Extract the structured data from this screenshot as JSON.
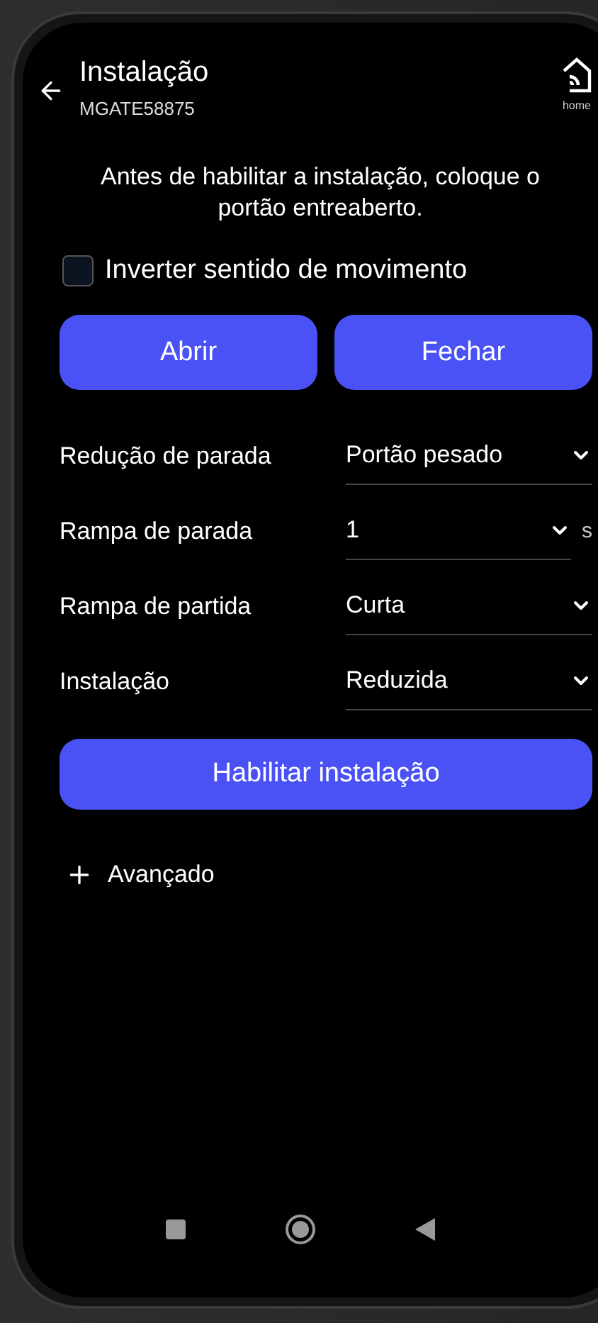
{
  "header": {
    "title": "Instalação",
    "subtitle": "MGATE58875",
    "home_label": "home"
  },
  "message": "Antes de habilitar a instalação, coloque o portão entreaberto.",
  "invert_checkbox": {
    "label": "Inverter sentido de movimento",
    "checked": false
  },
  "buttons": [
    "Abrir",
    "Fechar"
  ],
  "settings": [
    {
      "label": "Redução de parada",
      "value": "Portão pesado"
    },
    {
      "label": "Rampa de parada",
      "value": "1",
      "unit": "s"
    },
    {
      "label": "Rampa de partida",
      "value": "Curta"
    },
    {
      "label": "Instalação",
      "value": "Reduzida"
    }
  ],
  "primary_button": "Habilitar instalação",
  "advanced": {
    "label": "Avançado",
    "expanded": false
  }
}
